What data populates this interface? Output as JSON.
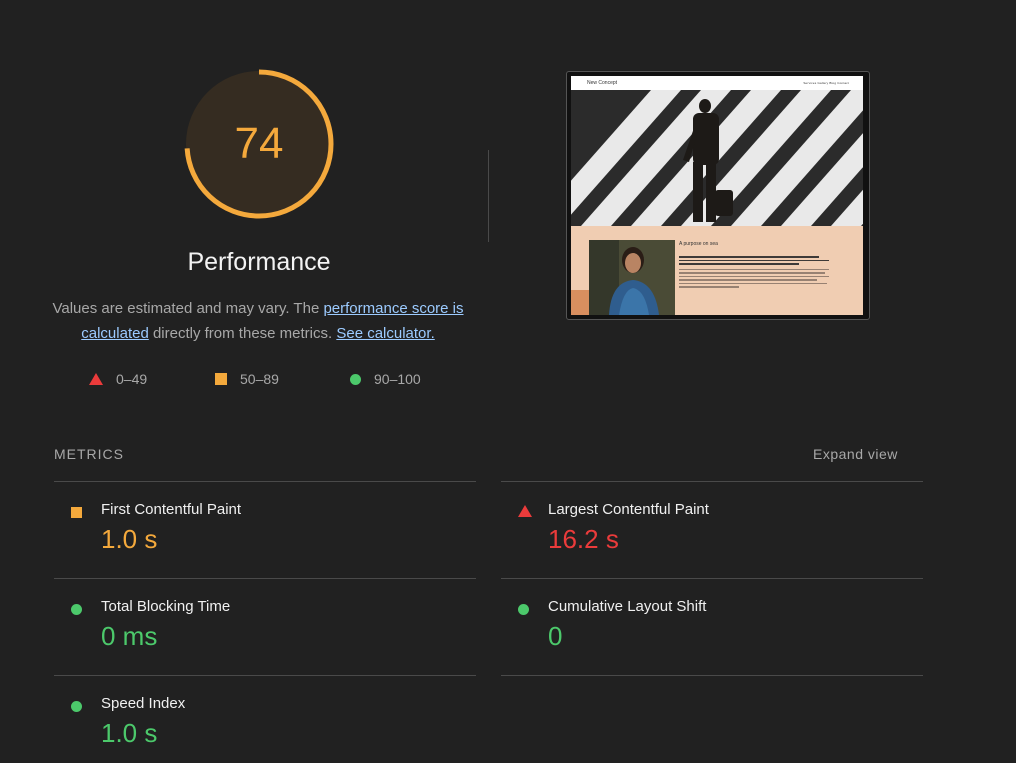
{
  "colors": {
    "background": "#212121",
    "fail": "#eb3b3b",
    "average": "#f4a93c",
    "pass": "#4cc96b",
    "link": "#9ccbff"
  },
  "gauge": {
    "score": "74",
    "score_fraction": 0.74,
    "label": "Performance"
  },
  "description": {
    "text_before": "Values are estimated and may vary. The ",
    "link_score": "performance score is calculated",
    "text_middle": " directly from these metrics. ",
    "link_calculator": "See calculator."
  },
  "legend": [
    {
      "icon": "triangle-icon",
      "label": "0–49"
    },
    {
      "icon": "square-icon",
      "label": "50–89"
    },
    {
      "icon": "circle-icon",
      "label": "90–100"
    }
  ],
  "preview": {
    "site_name": "New Concept",
    "nav_links": "Services  Gallery  Blog  Contact",
    "section_heading": "A purpose on sea"
  },
  "metrics_section": {
    "title": "METRICS",
    "expand_label": "Expand view",
    "items": [
      {
        "name": "First Contentful Paint",
        "value": "1.0 s",
        "rating": "average",
        "icon": "square-icon"
      },
      {
        "name": "Largest Contentful Paint",
        "value": "16.2 s",
        "rating": "fail",
        "icon": "triangle-icon"
      },
      {
        "name": "Total Blocking Time",
        "value": "0 ms",
        "rating": "pass",
        "icon": "circle-icon"
      },
      {
        "name": "Cumulative Layout Shift",
        "value": "0",
        "rating": "pass",
        "icon": "circle-icon"
      },
      {
        "name": "Speed Index",
        "value": "1.0 s",
        "rating": "pass",
        "icon": "circle-icon"
      }
    ]
  }
}
